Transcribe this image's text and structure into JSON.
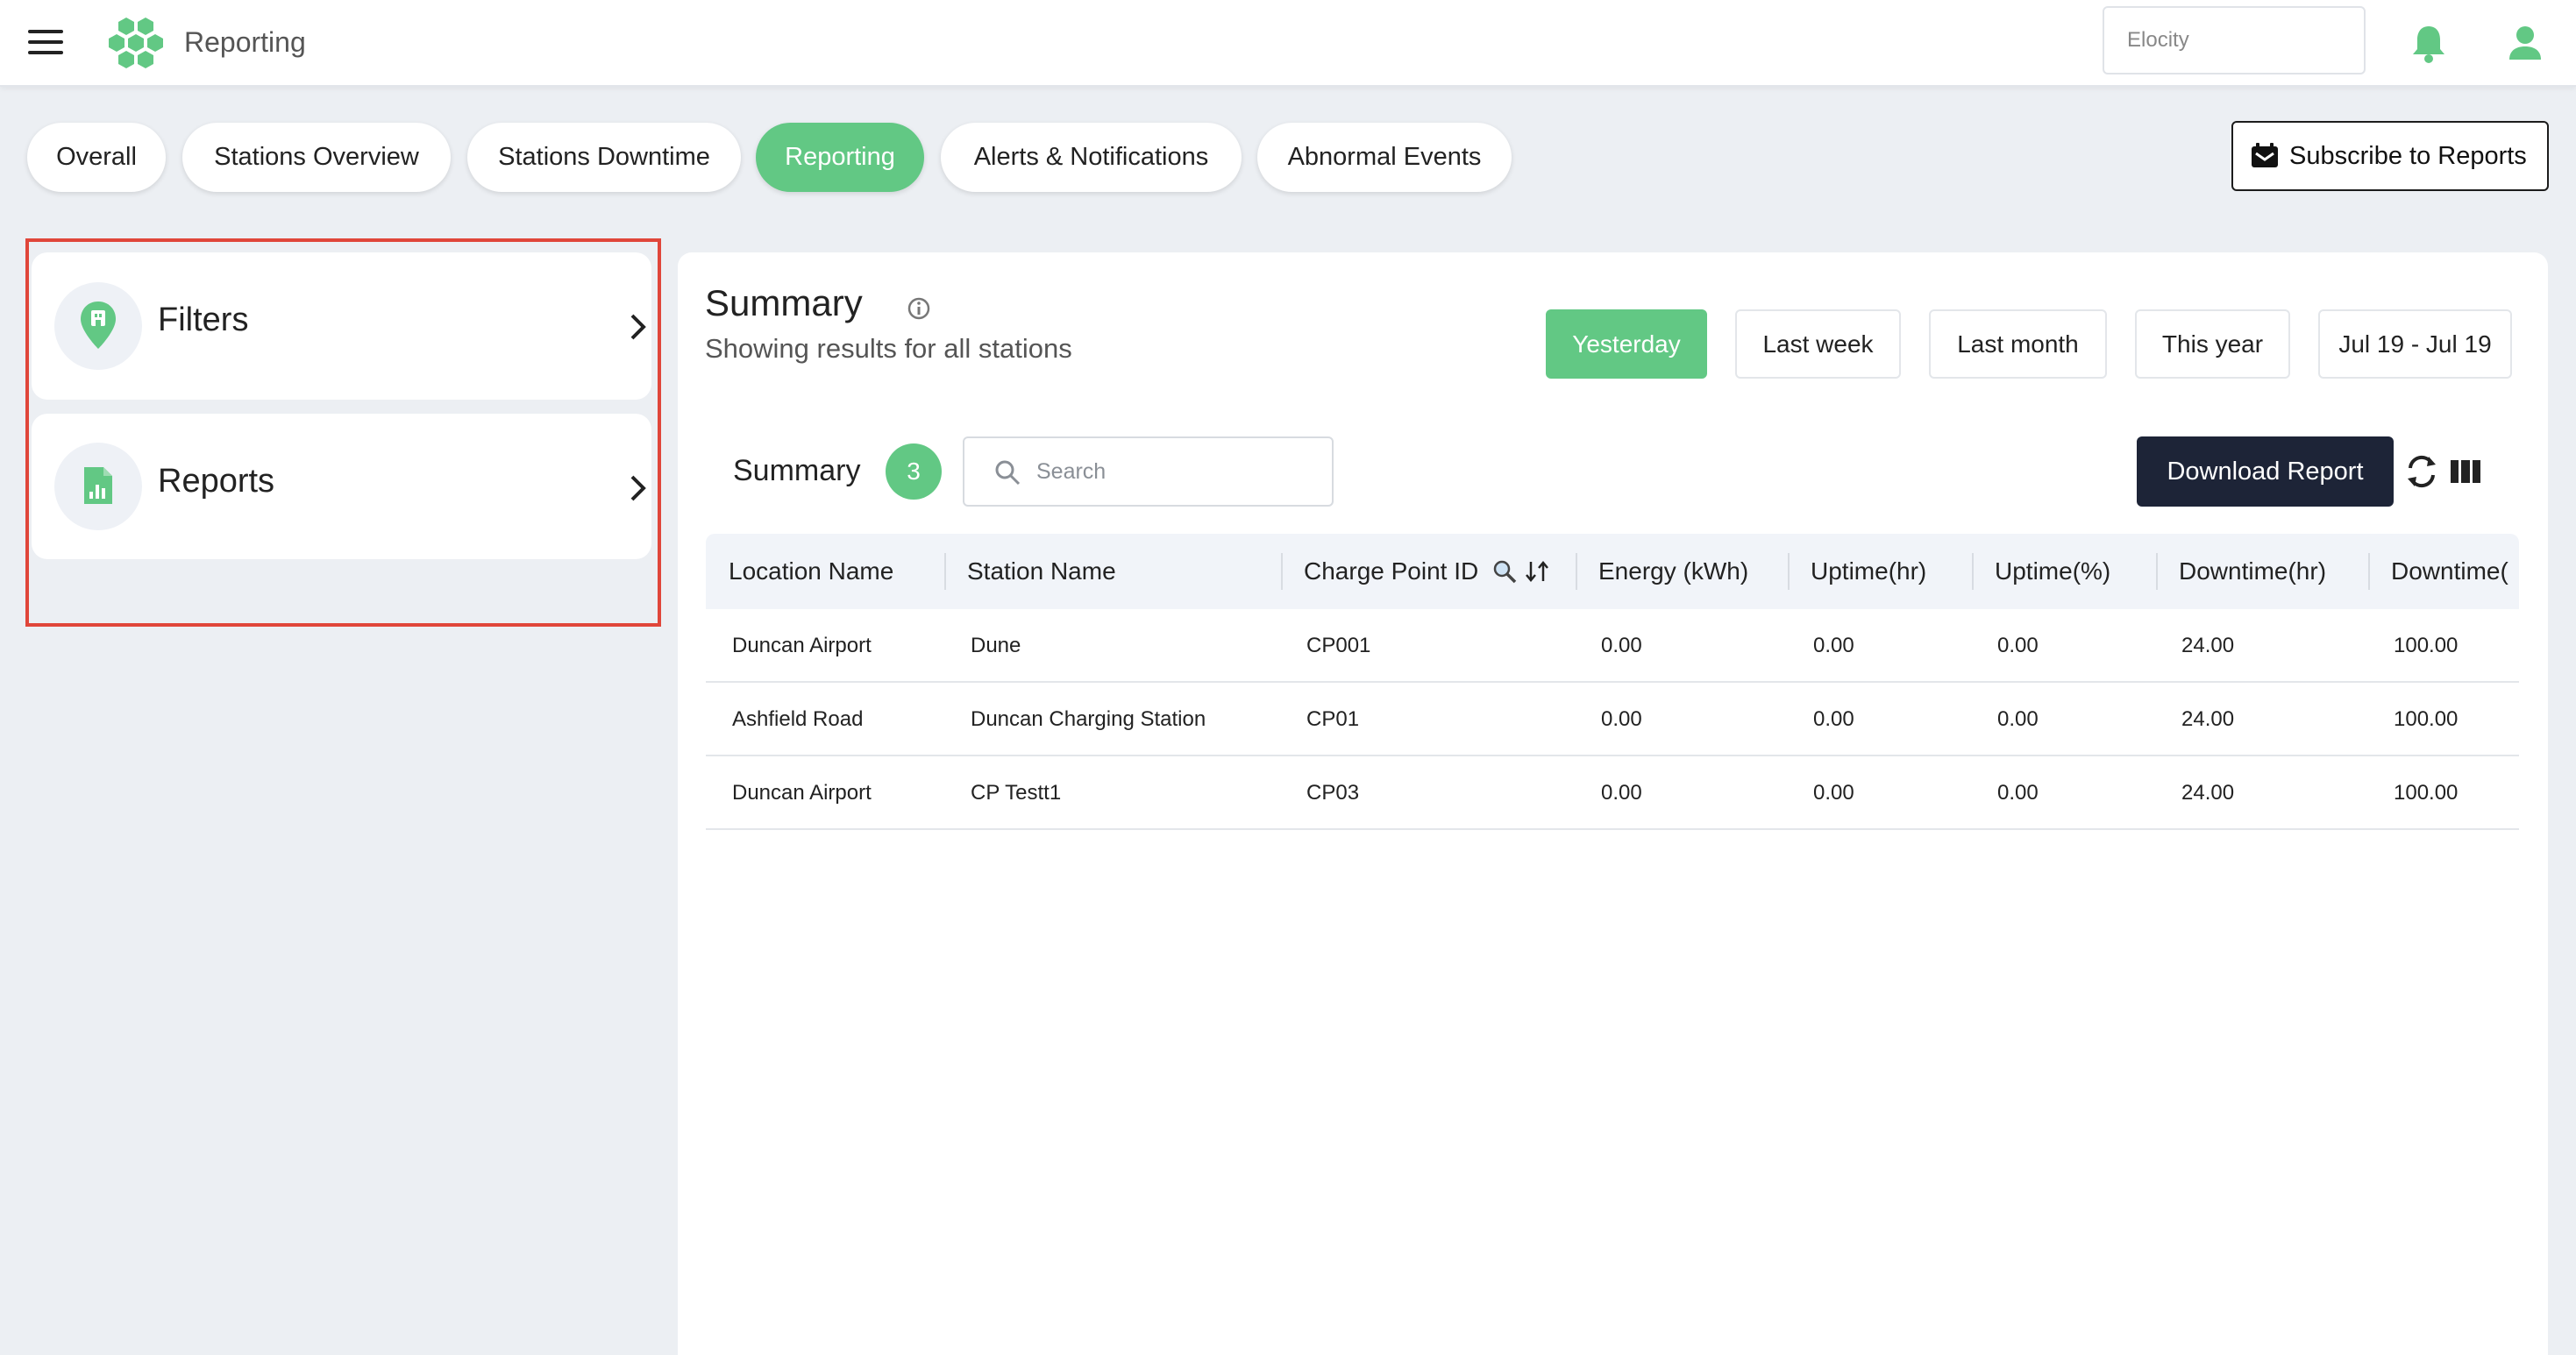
{
  "header": {
    "app_title": "Reporting",
    "org_placeholder": "Elocity"
  },
  "tabs": [
    {
      "label": "Overall",
      "active": false
    },
    {
      "label": "Stations Overview",
      "active": false
    },
    {
      "label": "Stations Downtime",
      "active": false
    },
    {
      "label": "Reporting",
      "active": true
    },
    {
      "label": "Alerts & Notifications",
      "active": false
    },
    {
      "label": "Abnormal Events",
      "active": false
    }
  ],
  "subscribe_label": "Subscribe to Reports",
  "sidebar": {
    "items": [
      {
        "label": "Filters",
        "icon": "map-pin-icon"
      },
      {
        "label": "Reports",
        "icon": "report-chart-icon"
      }
    ]
  },
  "summary": {
    "title": "Summary",
    "subtitle": "Showing results for all stations",
    "ranges": [
      {
        "label": "Yesterday",
        "active": true
      },
      {
        "label": "Last week",
        "active": false
      },
      {
        "label": "Last month",
        "active": false
      },
      {
        "label": "This year",
        "active": false
      },
      {
        "label": "Jul 19 - Jul 19",
        "active": false
      }
    ]
  },
  "table": {
    "title": "Summary",
    "count": "3",
    "search_placeholder": "Search",
    "download_label": "Download Report",
    "columns": [
      "Location Name",
      "Station Name",
      "Charge Point ID",
      "Energy (kWh)",
      "Uptime(hr)",
      "Uptime(%)",
      "Downtime(hr)",
      "Downtime("
    ],
    "rows": [
      [
        "Duncan Airport",
        "Dune",
        "CP001",
        "0.00",
        "0.00",
        "0.00",
        "24.00",
        "100.00"
      ],
      [
        "Ashfield Road",
        "Duncan Charging Station",
        "CP01",
        "0.00",
        "0.00",
        "0.00",
        "24.00",
        "100.00"
      ],
      [
        "Duncan Airport",
        "CP Testt1",
        "CP03",
        "0.00",
        "0.00",
        "0.00",
        "24.00",
        "100.00"
      ]
    ]
  },
  "colors": {
    "accent_green": "#62c884",
    "dark_button": "#1d2437",
    "highlight_red": "#e0463a",
    "background": "#eceff3"
  }
}
